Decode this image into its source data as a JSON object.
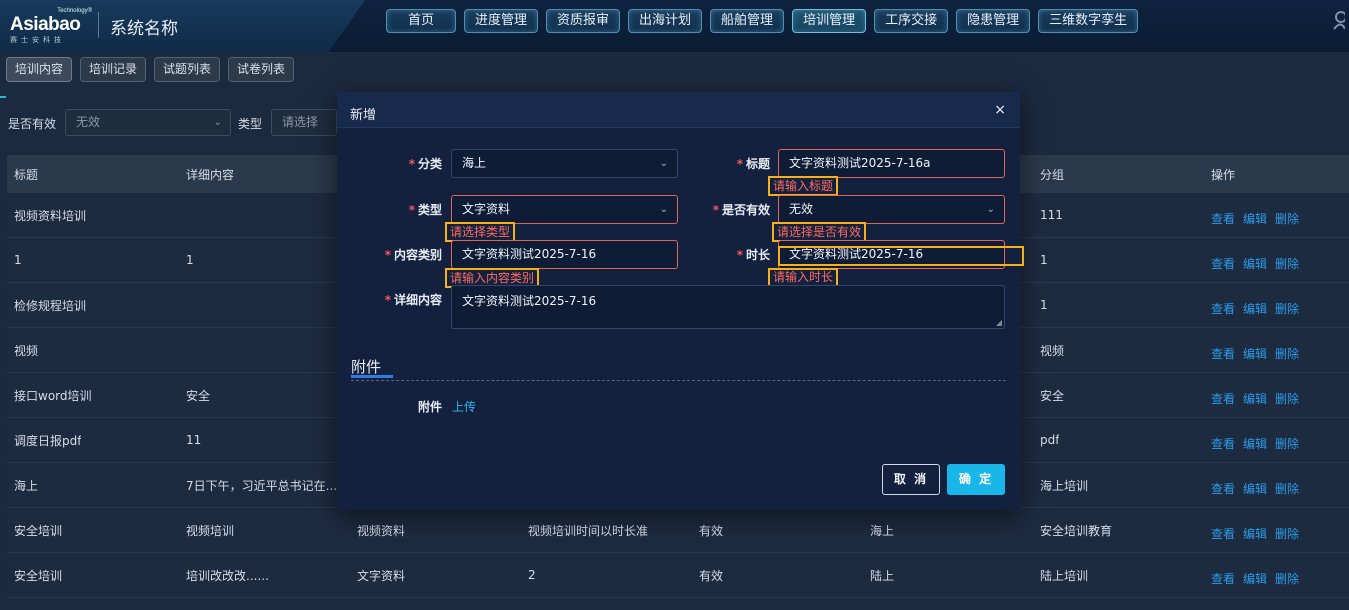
{
  "header": {
    "logo": {
      "brand": "Asiabao",
      "tm": "Technology®",
      "sub": "赛士安科技"
    },
    "system_name": "系统名称",
    "nav": [
      "首页",
      "进度管理",
      "资质报审",
      "出海计划",
      "船舶管理",
      "培训管理",
      "工序交接",
      "隐患管理",
      "三维数字孪生"
    ],
    "active_nav": "培训管理"
  },
  "subtabs": [
    "培训内容",
    "培训记录",
    "试题列表",
    "试卷列表"
  ],
  "filter": {
    "valid_label": "是否有效",
    "valid_value": "无效",
    "type_label": "类型",
    "type_placeholder": "请选择"
  },
  "table": {
    "headers": {
      "title": "标题",
      "detail": "详细内容",
      "group": "分组",
      "ops": "操作"
    },
    "rows": [
      {
        "title": "视频资料培训",
        "detail": "",
        "c3": "",
        "c4": "",
        "c5": "",
        "c6": "",
        "group": "111"
      },
      {
        "title": "1",
        "detail": "1",
        "c3": "",
        "c4": "",
        "c5": "",
        "c6": "",
        "group": "1"
      },
      {
        "title": "检修规程培训",
        "detail": "",
        "c3": "",
        "c4": "",
        "c5": "",
        "c6": "",
        "group": "1"
      },
      {
        "title": "视频",
        "detail": "",
        "c3": "",
        "c4": "",
        "c5": "",
        "c6": "",
        "group": "视频"
      },
      {
        "title": "接口word培训",
        "detail": "安全",
        "c3": "",
        "c4": "",
        "c5": "",
        "c6": "",
        "group": "安全"
      },
      {
        "title": "调度日报pdf",
        "detail": "11",
        "c3": "",
        "c4": "",
        "c5": "",
        "c6": "",
        "group": "pdf"
      },
      {
        "title": "海上",
        "detail": "7日下午，习近平总书记在...",
        "c3": "",
        "c4": "",
        "c5": "",
        "c6": "",
        "group": "海上培训"
      },
      {
        "title": "安全培训",
        "detail": "视频培训",
        "c3": "视频资料",
        "c4": "视频培训时间以时长准",
        "c5": "有效",
        "c6": "海上",
        "group": "安全培训教育"
      },
      {
        "title": "安全培训",
        "detail": "培训改改改......",
        "c3": "文字资料",
        "c4": "2",
        "c5": "有效",
        "c6": "陆上",
        "group": "陆上培训"
      }
    ],
    "op_view": "查看",
    "op_edit": "编辑",
    "op_delete": "删除"
  },
  "modal": {
    "title": "新增",
    "close": "×",
    "fields": {
      "category": {
        "label": "分类",
        "value": "海上"
      },
      "title": {
        "label": "标题",
        "value": "文字资料测试2025-7-16a",
        "error": "请输入标题"
      },
      "type": {
        "label": "类型",
        "value": "文字资料",
        "error": "请选择类型"
      },
      "valid": {
        "label": "是否有效",
        "value": "无效",
        "error": "请选择是否有效"
      },
      "content_type": {
        "label": "内容类别",
        "value": "文字资料测试2025-7-16",
        "error": "请输入内容类别"
      },
      "duration": {
        "label": "时长",
        "value": "文字资料测试2025-7-16",
        "error": "请输入时长"
      },
      "detail": {
        "label": "详细内容",
        "value": "文字资料测试2025-7-16"
      }
    },
    "attachment_section": "附件",
    "attachment_label": "附件",
    "upload": "上传",
    "cancel": "取 消",
    "ok": "确 定"
  }
}
